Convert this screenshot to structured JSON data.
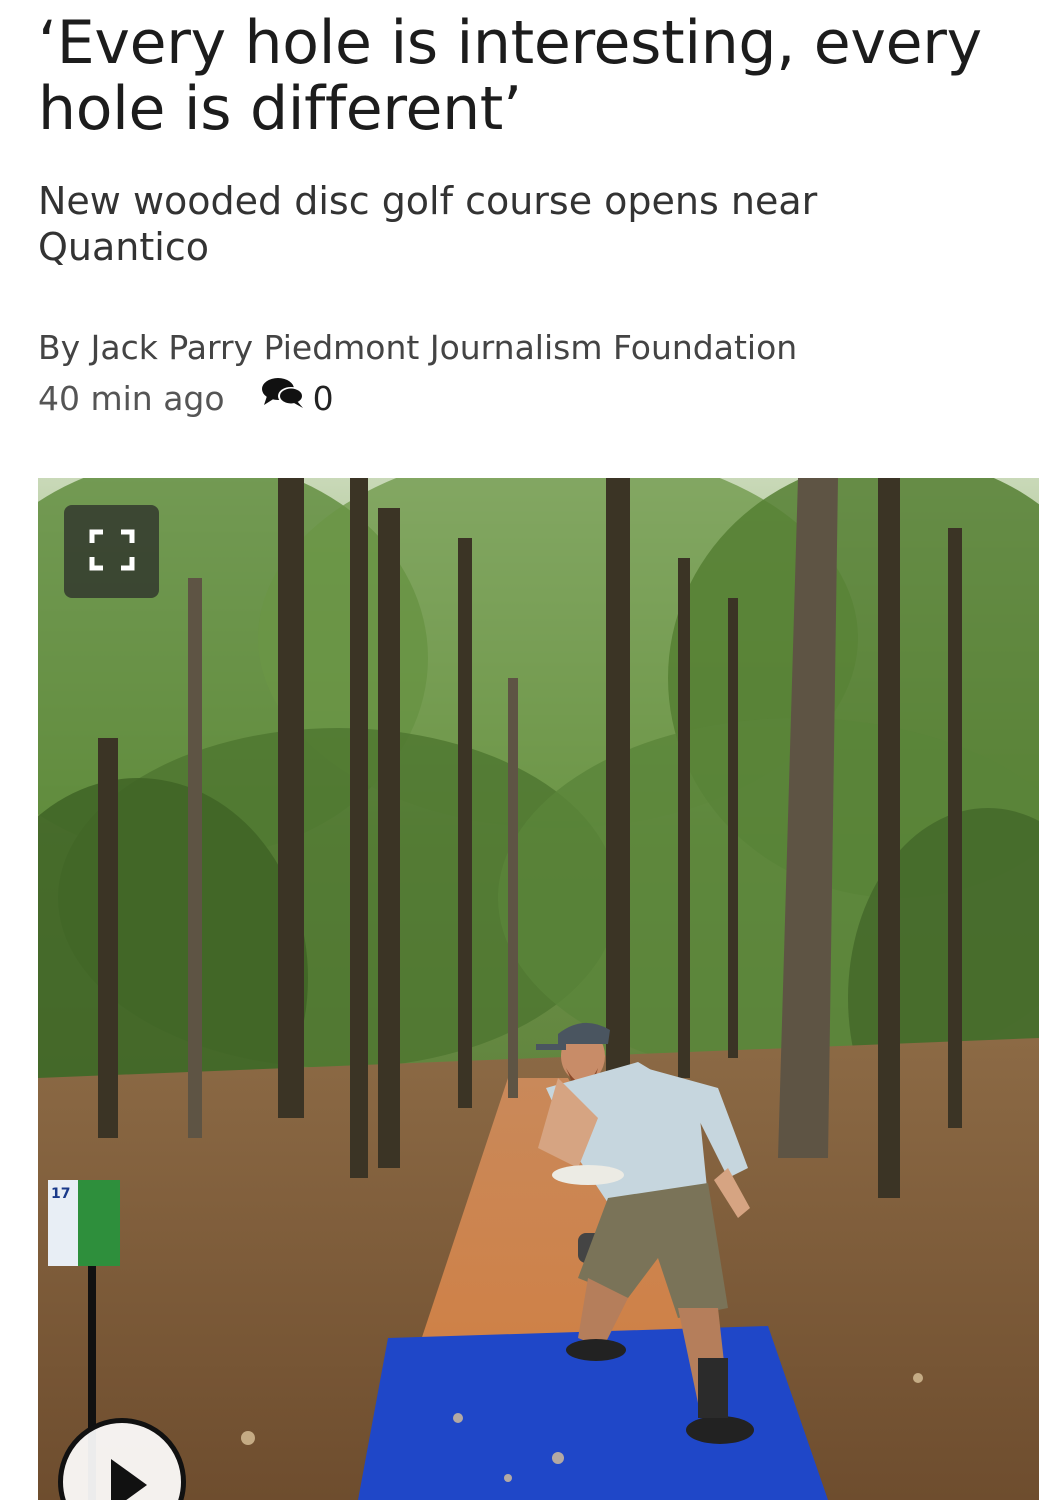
{
  "article": {
    "headline": "‘Every hole is interesting, every hole is different’",
    "subhead": "New wooded disc golf course opens near Quantico",
    "byline": "By Jack Parry Piedmont Journalism Foundation",
    "timestamp": "40 min ago",
    "comment_count": "0",
    "comment_icon": "comment-bubbles-icon"
  },
  "photo": {
    "expand_icon": "expand-icon",
    "play_icon": "play-icon",
    "basket_sign_number": "17"
  },
  "colors": {
    "headline_text": "#1c1c1c",
    "meta_text": "#555555",
    "tee_pad": "#1f47c8",
    "foliage": "#4f7a32",
    "path": "#b8703a"
  }
}
